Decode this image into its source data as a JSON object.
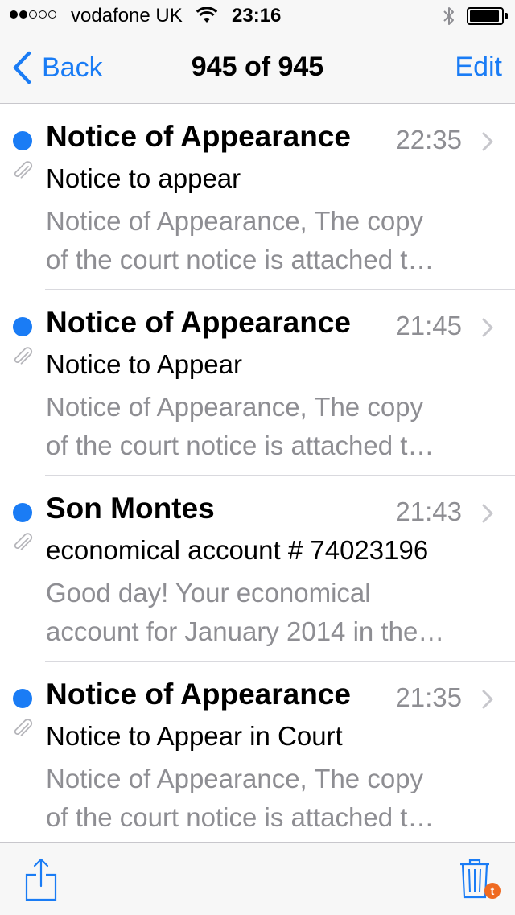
{
  "status_bar": {
    "signal_filled": 2,
    "signal_total": 5,
    "carrier": "vodafone UK",
    "time": "23:16",
    "battery_level": 0.95
  },
  "nav": {
    "back_label": "Back",
    "title": "945 of 945",
    "edit_label": "Edit"
  },
  "messages": [
    {
      "sender": "Notice of Appearance",
      "time": "22:35",
      "subject": "Notice to appear",
      "preview_line1": "Notice of Appearance, The copy",
      "preview_line2": "of the court notice is attached t…",
      "unread": true,
      "has_attachment": true
    },
    {
      "sender": "Notice of Appearance",
      "time": "21:45",
      "subject": "Notice to Appear",
      "preview_line1": "Notice of Appearance, The copy",
      "preview_line2": "of the court notice is attached t…",
      "unread": true,
      "has_attachment": true
    },
    {
      "sender": "Son Montes",
      "time": "21:43",
      "subject": "economical account # 74023196",
      "preview_line1": "Good day! Your economical",
      "preview_line2": "account for January 2014 in the…",
      "unread": true,
      "has_attachment": true
    },
    {
      "sender": "Notice of Appearance",
      "time": "21:35",
      "subject": "Notice to Appear in Court",
      "preview_line1": "Notice of Appearance, The copy",
      "preview_line2": "of the court notice is attached t…",
      "unread": true,
      "has_attachment": true
    }
  ],
  "toolbar": {
    "trash_badge": "t",
    "icons": [
      "share-icon",
      "trash-icon"
    ]
  },
  "colors": {
    "accent": "#1a7cf5",
    "secondary_text": "#8e8e93",
    "badge": "#ef6a21"
  }
}
